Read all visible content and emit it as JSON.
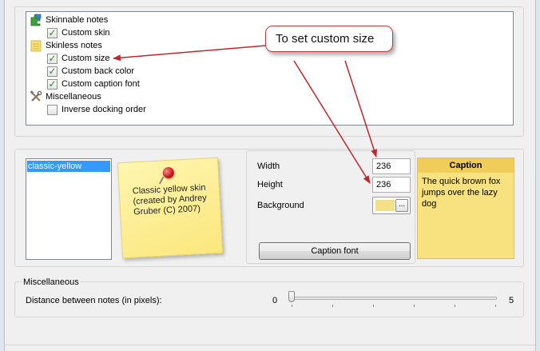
{
  "options_tree": {
    "categories": [
      {
        "label": "Skinnable notes",
        "icon": "puzzle-icon",
        "items": [
          {
            "label": "Custom skin",
            "checked": true
          }
        ]
      },
      {
        "label": "Skinless notes",
        "icon": "notepad-icon",
        "items": [
          {
            "label": "Custom size",
            "checked": true
          },
          {
            "label": "Custom back color",
            "checked": true
          },
          {
            "label": "Custom caption font",
            "checked": true
          }
        ]
      },
      {
        "label": "Miscellaneous",
        "icon": "tools-icon",
        "items": [
          {
            "label": "Inverse docking order",
            "checked": false
          }
        ]
      }
    ]
  },
  "skins": {
    "selected": "classic-yellow",
    "preview_text": "Classic yellow skin (created by Andrey Gruber (C) 2007)"
  },
  "size": {
    "width_label": "Width",
    "width_value": "236",
    "height_label": "Height",
    "height_value": "236",
    "background_label": "Background",
    "background_color": "#f5e08a",
    "color_button_label": "...",
    "caption_font_label": "Caption font"
  },
  "preview": {
    "caption": "Caption",
    "body": "The quick brown fox jumps over the lazy dog"
  },
  "misc": {
    "title": "Miscellaneous",
    "distance_label": "Distance between notes (in pixels):",
    "slider_min": "0",
    "slider_max": "5",
    "slider_value": 0
  },
  "annotation": {
    "callout_text": "To set custom size"
  },
  "colors": {
    "selection": "#3399ff",
    "note_yellow": "#f7e27f",
    "note_caption": "#f0cc58",
    "arrow_red": "#c0272d"
  }
}
